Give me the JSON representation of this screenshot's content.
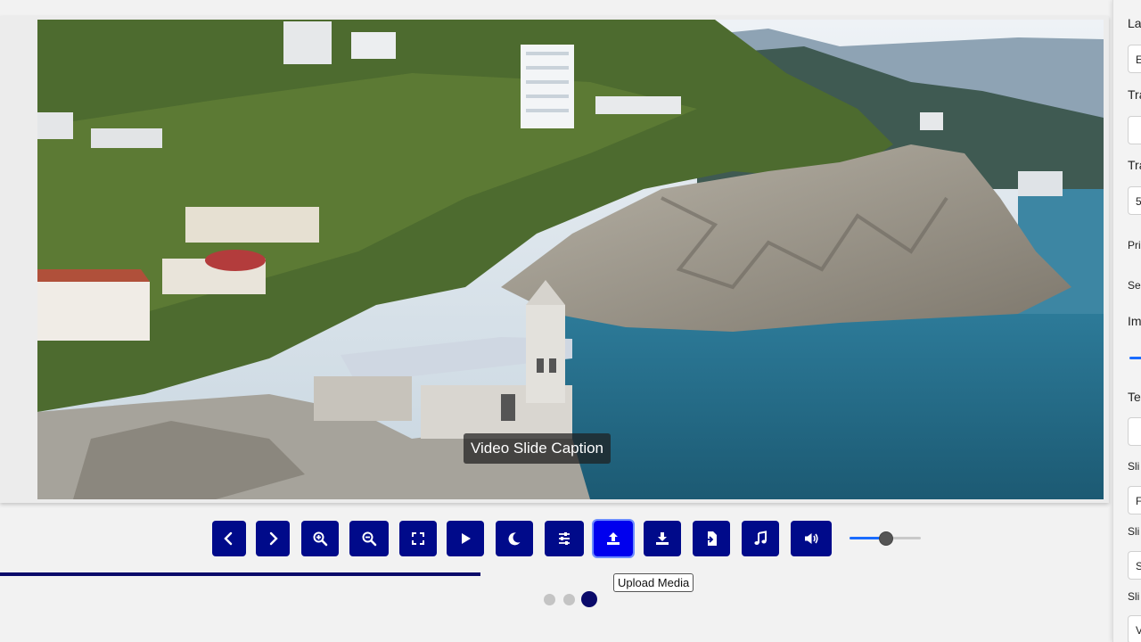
{
  "slide": {
    "caption": "Video Slide Caption"
  },
  "toolbar": {
    "buttons": [
      {
        "name": "previous-button",
        "icon": "chevron-left-icon"
      },
      {
        "name": "next-button",
        "icon": "chevron-right-icon"
      },
      {
        "name": "zoom-in-button",
        "icon": "zoom-in-icon"
      },
      {
        "name": "zoom-out-button",
        "icon": "zoom-out-icon"
      },
      {
        "name": "fullscreen-button",
        "icon": "fullscreen-icon"
      },
      {
        "name": "play-button",
        "icon": "play-icon"
      },
      {
        "name": "dark-mode-button",
        "icon": "moon-icon"
      },
      {
        "name": "settings-button",
        "icon": "sliders-icon"
      },
      {
        "name": "upload-media-button",
        "icon": "upload-icon",
        "active": true
      },
      {
        "name": "download-button",
        "icon": "download-icon"
      },
      {
        "name": "import-file-button",
        "icon": "file-import-icon"
      },
      {
        "name": "music-button",
        "icon": "music-icon"
      },
      {
        "name": "volume-button",
        "icon": "volume-icon"
      }
    ],
    "tooltip": "Upload Media",
    "volume_level": 0.5,
    "progress": 0.433
  },
  "slide_dots": {
    "count": 3,
    "active_index": 2
  },
  "colors": {
    "button": "#000a8a",
    "button_active": "#0000ee",
    "progress": "#0a0a6a",
    "accent": "#1a6cff"
  },
  "panel": {
    "labels": [
      "La",
      "Tra",
      "Tra",
      "Pri",
      "Sec",
      "Ima",
      "Tex",
      "Sli",
      "Sli",
      "Sli"
    ],
    "fields": [
      "E",
      "",
      "5",
      "",
      "F",
      "S",
      "V"
    ]
  }
}
